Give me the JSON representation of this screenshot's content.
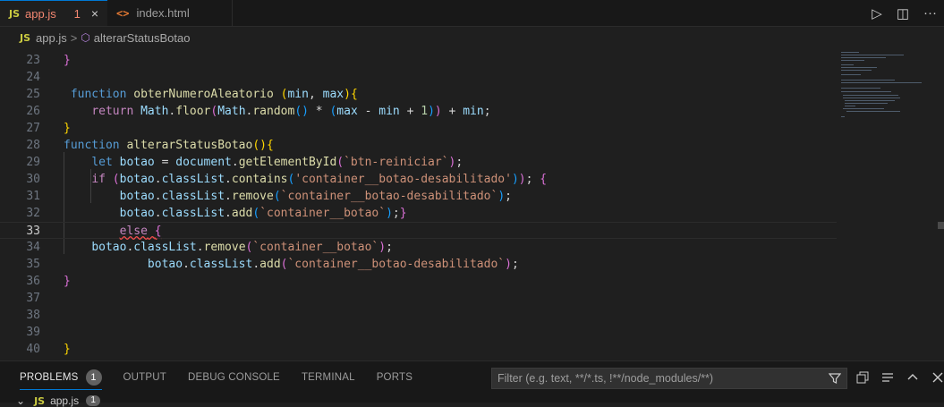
{
  "tabs": [
    {
      "badge": "JS",
      "label": "app.js",
      "problems": "1",
      "close": "×"
    },
    {
      "badge": "<>",
      "label": "index.html"
    }
  ],
  "title_actions": {
    "run": "▷",
    "split": "◫",
    "more": "···"
  },
  "breadcrumb": {
    "file_badge": "JS",
    "file": "app.js",
    "separator": ">",
    "symbol_icon": "⬡",
    "symbol": "alterarStatusBotao"
  },
  "editor": {
    "current_line": "33",
    "lines": [
      {
        "n": "23",
        "tokens": [
          {
            "t": "}",
            "c": "br2"
          }
        ]
      },
      {
        "n": "24",
        "tokens": []
      },
      {
        "n": "25",
        "tokens": [
          {
            "t": " "
          },
          {
            "t": "function",
            "c": "kw"
          },
          {
            "t": " "
          },
          {
            "t": "obterNumeroAleatorio",
            "c": "fn"
          },
          {
            "t": " "
          },
          {
            "t": "(",
            "c": "br1"
          },
          {
            "t": "min",
            "c": "var"
          },
          {
            "t": ", ",
            "c": "pl"
          },
          {
            "t": "max",
            "c": "var"
          },
          {
            "t": ")",
            "c": "br1"
          },
          {
            "t": "{",
            "c": "br1"
          }
        ]
      },
      {
        "n": "26",
        "tokens": [
          {
            "t": "    "
          },
          {
            "t": "return",
            "c": "ctrl"
          },
          {
            "t": " "
          },
          {
            "t": "Math",
            "c": "var"
          },
          {
            "t": ".",
            "c": "pl"
          },
          {
            "t": "floor",
            "c": "fn"
          },
          {
            "t": "(",
            "c": "br2"
          },
          {
            "t": "Math",
            "c": "var"
          },
          {
            "t": ".",
            "c": "pl"
          },
          {
            "t": "random",
            "c": "fn"
          },
          {
            "t": "()",
            "c": "br3"
          },
          {
            "t": " * ",
            "c": "pl"
          },
          {
            "t": "(",
            "c": "br3"
          },
          {
            "t": "max",
            "c": "var"
          },
          {
            "t": " - ",
            "c": "pl"
          },
          {
            "t": "min",
            "c": "var"
          },
          {
            "t": " + ",
            "c": "pl"
          },
          {
            "t": "1",
            "c": "num"
          },
          {
            "t": ")",
            "c": "br3"
          },
          {
            "t": ")",
            "c": "br2"
          },
          {
            "t": " + ",
            "c": "pl"
          },
          {
            "t": "min",
            "c": "var"
          },
          {
            "t": ";",
            "c": "pl"
          }
        ]
      },
      {
        "n": "27",
        "tokens": [
          {
            "t": "}",
            "c": "br1"
          }
        ]
      },
      {
        "n": "28",
        "tokens": [
          {
            "t": "function",
            "c": "kw"
          },
          {
            "t": " "
          },
          {
            "t": "alterarStatusBotao",
            "c": "fn"
          },
          {
            "t": "()",
            "c": "br1"
          },
          {
            "t": "{",
            "c": "br1"
          }
        ]
      },
      {
        "n": "29",
        "tokens": [
          {
            "t": "    "
          },
          {
            "t": "let",
            "c": "kw"
          },
          {
            "t": " "
          },
          {
            "t": "botao",
            "c": "var"
          },
          {
            "t": " = ",
            "c": "pl"
          },
          {
            "t": "document",
            "c": "var"
          },
          {
            "t": ".",
            "c": "pl"
          },
          {
            "t": "getElementById",
            "c": "fn"
          },
          {
            "t": "(",
            "c": "br2"
          },
          {
            "t": "`btn-reiniciar`",
            "c": "str"
          },
          {
            "t": ")",
            "c": "br2"
          },
          {
            "t": ";",
            "c": "pl"
          }
        ]
      },
      {
        "n": "30",
        "tokens": [
          {
            "t": "    "
          },
          {
            "t": "if",
            "c": "ctrl"
          },
          {
            "t": " "
          },
          {
            "t": "(",
            "c": "br2"
          },
          {
            "t": "botao",
            "c": "var"
          },
          {
            "t": ".",
            "c": "pl"
          },
          {
            "t": "classList",
            "c": "var"
          },
          {
            "t": ".",
            "c": "pl"
          },
          {
            "t": "contains",
            "c": "fn"
          },
          {
            "t": "(",
            "c": "br3"
          },
          {
            "t": "'container__botao-desabilitado'",
            "c": "str"
          },
          {
            "t": ")",
            "c": "br3"
          },
          {
            "t": ")",
            "c": "br2"
          },
          {
            "t": "; ",
            "c": "pl"
          },
          {
            "t": "{",
            "c": "br2"
          }
        ]
      },
      {
        "n": "31",
        "tokens": [
          {
            "t": "        "
          },
          {
            "t": "botao",
            "c": "var"
          },
          {
            "t": ".",
            "c": "pl"
          },
          {
            "t": "classList",
            "c": "var"
          },
          {
            "t": ".",
            "c": "pl"
          },
          {
            "t": "remove",
            "c": "fn"
          },
          {
            "t": "(",
            "c": "br3"
          },
          {
            "t": "`container__botao-desabilitado`",
            "c": "str"
          },
          {
            "t": ")",
            "c": "br3"
          },
          {
            "t": ";",
            "c": "pl"
          }
        ]
      },
      {
        "n": "32",
        "tokens": [
          {
            "t": "        "
          },
          {
            "t": "botao",
            "c": "var"
          },
          {
            "t": ".",
            "c": "pl"
          },
          {
            "t": "classList",
            "c": "var"
          },
          {
            "t": ".",
            "c": "pl"
          },
          {
            "t": "add",
            "c": "fn"
          },
          {
            "t": "(",
            "c": "br3"
          },
          {
            "t": "`container__botao`",
            "c": "str"
          },
          {
            "t": ")",
            "c": "br3"
          },
          {
            "t": ";",
            "c": "pl"
          },
          {
            "t": "}",
            "c": "br2"
          }
        ]
      },
      {
        "n": "33",
        "tokens": [
          {
            "t": "        "
          },
          {
            "t": "else",
            "c": "ctrl sq"
          },
          {
            "t": " ",
            "c": "sq"
          },
          {
            "t": "{",
            "c": "br2 sq"
          }
        ]
      },
      {
        "n": "34",
        "tokens": [
          {
            "t": "    "
          },
          {
            "t": "botao",
            "c": "var"
          },
          {
            "t": ".",
            "c": "pl"
          },
          {
            "t": "classList",
            "c": "var"
          },
          {
            "t": ".",
            "c": "pl"
          },
          {
            "t": "remove",
            "c": "fn"
          },
          {
            "t": "(",
            "c": "br2"
          },
          {
            "t": "`container__botao`",
            "c": "str"
          },
          {
            "t": ")",
            "c": "br2"
          },
          {
            "t": ";",
            "c": "pl"
          }
        ]
      },
      {
        "n": "35",
        "tokens": [
          {
            "t": "            "
          },
          {
            "t": "botao",
            "c": "var"
          },
          {
            "t": ".",
            "c": "pl"
          },
          {
            "t": "classList",
            "c": "var"
          },
          {
            "t": ".",
            "c": "pl"
          },
          {
            "t": "add",
            "c": "fn"
          },
          {
            "t": "(",
            "c": "br2"
          },
          {
            "t": "`container__botao-desabilitado`",
            "c": "str"
          },
          {
            "t": ")",
            "c": "br2"
          },
          {
            "t": ";",
            "c": "pl"
          }
        ]
      },
      {
        "n": "36",
        "tokens": [
          {
            "t": "}",
            "c": "br2"
          }
        ]
      },
      {
        "n": "37",
        "tokens": []
      },
      {
        "n": "38",
        "tokens": []
      },
      {
        "n": "39",
        "tokens": []
      },
      {
        "n": "40",
        "tokens": [
          {
            "t": "}",
            "c": "br1"
          }
        ]
      }
    ]
  },
  "panel": {
    "tabs": [
      {
        "label": "PROBLEMS",
        "count": "1"
      },
      {
        "label": "OUTPUT"
      },
      {
        "label": "DEBUG CONSOLE"
      },
      {
        "label": "TERMINAL"
      },
      {
        "label": "PORTS"
      }
    ],
    "filter_placeholder": "Filter (e.g. text, **/*.ts, !**/node_modules/**)",
    "tree": {
      "chevron": "⌄",
      "badge": "JS",
      "file": "app.js",
      "count": "1"
    }
  },
  "colors": {
    "accent": "#0078d4",
    "error": "#f48771",
    "editor_bg": "#1f1f1f"
  }
}
